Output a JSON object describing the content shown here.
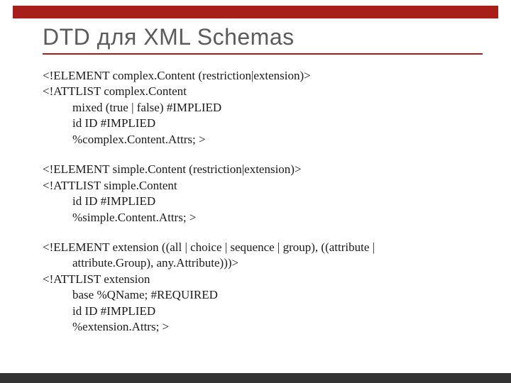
{
  "title": "DTD для XML Schemas",
  "blocks": {
    "complex": {
      "l1": "<!ELEMENT complex.Content (restriction|extension)>",
      "l2": "<!ATTLIST complex.Content",
      "l3": "mixed (true | false) #IMPLIED",
      "l4": "id   ID   #IMPLIED",
      "l5": "%complex.Content.Attrs; >"
    },
    "simple": {
      "l1": "<!ELEMENT simple.Content (restriction|extension)>",
      "l2": "<!ATTLIST simple.Content",
      "l3": "id   ID   #IMPLIED",
      "l4": "%simple.Content.Attrs; >"
    },
    "extension": {
      "l1a": "<!ELEMENT extension ((all | choice | sequence | group),   ((attribute |",
      "l1b": "attribute.Group), any.Attribute)))>",
      "l2": "<!ATTLIST extension",
      "l3": "base  %QName; #REQUIRED",
      "l4": "id ID #IMPLIED",
      "l5": "%extension.Attrs; >"
    }
  }
}
